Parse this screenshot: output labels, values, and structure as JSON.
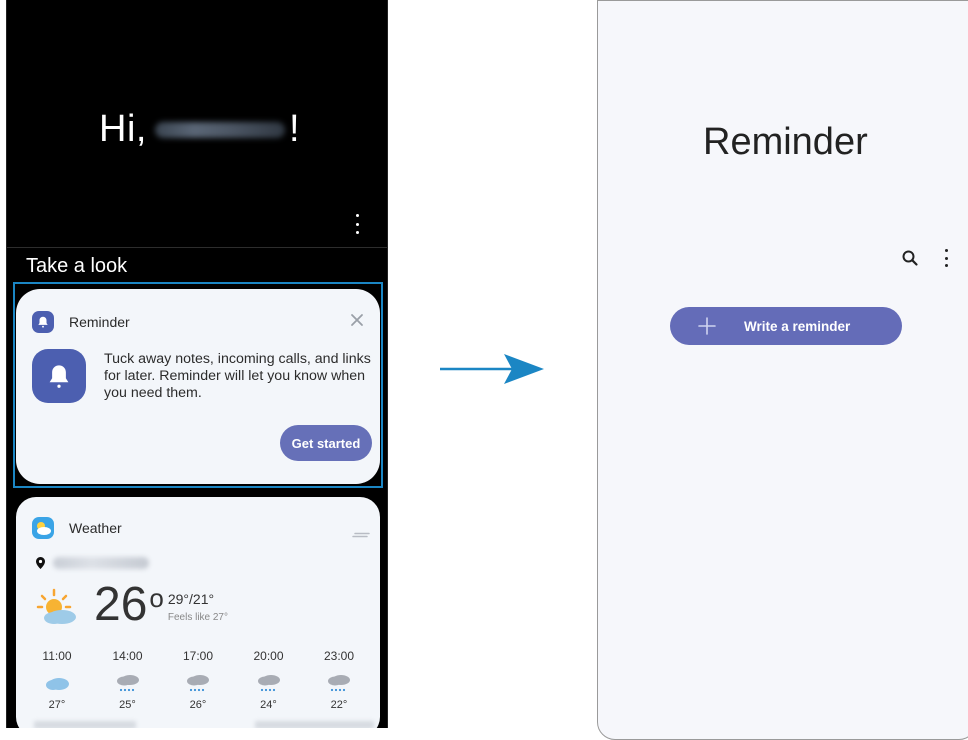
{
  "left_screen": {
    "greeting_prefix": "Hi,",
    "greeting_suffix": "!",
    "section_title": "Take a look",
    "reminder_card": {
      "title": "Reminder",
      "body": "Tuck away notes, incoming calls, and links for later. Reminder will let you know when you need them.",
      "button_label": "Get started"
    },
    "weather_card": {
      "title": "Weather",
      "current_temp": "26",
      "degree_symbol": "°",
      "hi_lo": "29°/21°",
      "feels_like": "Feels like 27°",
      "hourly": [
        {
          "time": "11:00",
          "temp": "27°",
          "icon": "cloudy-icon"
        },
        {
          "time": "14:00",
          "temp": "25°",
          "icon": "rain-icon"
        },
        {
          "time": "17:00",
          "temp": "26°",
          "icon": "rain-icon"
        },
        {
          "time": "20:00",
          "temp": "24°",
          "icon": "rain-icon"
        },
        {
          "time": "23:00",
          "temp": "22°",
          "icon": "rain-icon"
        }
      ]
    }
  },
  "right_screen": {
    "title": "Reminder",
    "write_button_label": "Write a reminder"
  },
  "colors": {
    "accent": "#646cb8",
    "highlight_border": "#1b86c4",
    "arrow": "#1b86c4"
  }
}
